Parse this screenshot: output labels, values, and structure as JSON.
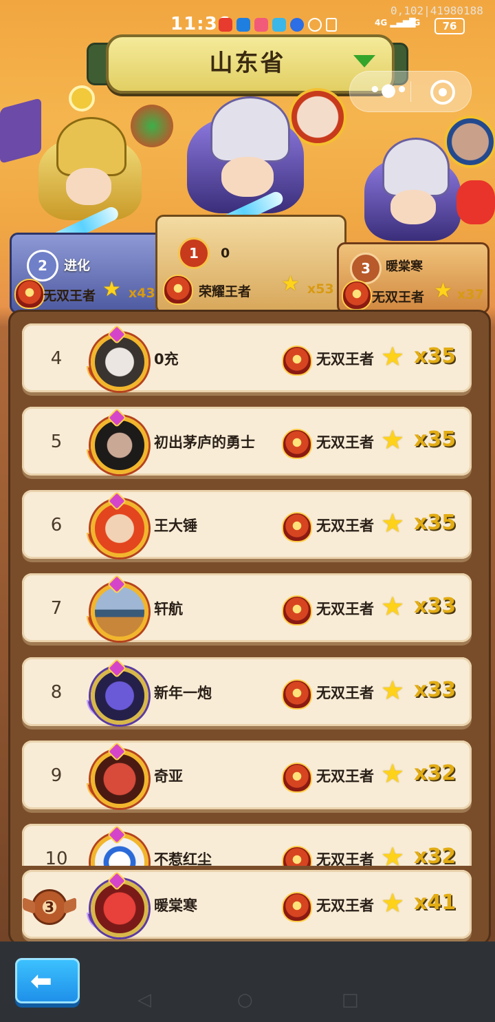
{
  "status_bar": {
    "time": "11:36",
    "debug_text": "0,102|41980188",
    "network1": "4G",
    "network2": "4G",
    "battery": "76"
  },
  "header": {
    "province": "山东省",
    "dropdown_icon": "triangle-down-icon"
  },
  "capsule": {
    "more_icon": "more-dots-icon",
    "close_icon": "target-circle-icon"
  },
  "podium": {
    "first": {
      "rank": "1",
      "name": "0",
      "tier": "荣耀王者",
      "count": "x53"
    },
    "second": {
      "rank": "2",
      "name": "进化",
      "tier": "无双王者",
      "count": "x43"
    },
    "third": {
      "rank": "3",
      "name": "暖棠寒",
      "tier": "无双王者",
      "count": "x37"
    }
  },
  "leaderboard": {
    "rows": [
      {
        "rank": "4",
        "name": "0充",
        "tier": "无双王者",
        "count": "x35"
      },
      {
        "rank": "5",
        "name": "初出茅庐的勇士",
        "tier": "无双王者",
        "count": "x35"
      },
      {
        "rank": "6",
        "name": "王大锤",
        "tier": "无双王者",
        "count": "x35"
      },
      {
        "rank": "7",
        "name": "轩航",
        "tier": "无双王者",
        "count": "x33"
      },
      {
        "rank": "8",
        "name": "新年一炮",
        "tier": "无双王者",
        "count": "x33"
      },
      {
        "rank": "9",
        "name": "奇亚",
        "tier": "无双王者",
        "count": "x32"
      },
      {
        "rank": "10",
        "name": "不惹红尘",
        "tier": "无双王者",
        "count": "x32"
      }
    ],
    "my_row": {
      "rank": "3",
      "name": "暖棠寒",
      "tier": "无双王者",
      "count": "x41"
    }
  },
  "footer": {
    "back_icon": "back-arrow-icon"
  },
  "colors": {
    "accent_gold": "#e2ac14",
    "row_bg": "#f8ecd6",
    "panel": "#7a4d2a",
    "back_button": "#1d8ee8"
  }
}
